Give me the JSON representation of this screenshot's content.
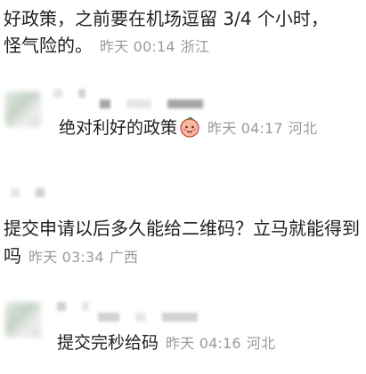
{
  "comments": [
    {
      "text_line1": "好政策，之前要在机场逗留 3/4 个小时，",
      "text_line2": "怪气险的。",
      "time": "昨天 00:14",
      "location": "浙江"
    },
    {
      "text": "绝对利好的政策",
      "emoji": "peach-face-icon",
      "time": "昨天 04:17",
      "location": "河北"
    },
    {
      "text": "提交申请以后多久能给二维码？立马就能得到吗",
      "time": "昨天 03:34",
      "location": "广西"
    },
    {
      "text": "提交完秒给码",
      "time": "昨天 04:16",
      "location": "河北"
    }
  ],
  "colors": {
    "text": "#1f1f1f",
    "meta": "#9a9a9a",
    "background": "#ffffff"
  }
}
